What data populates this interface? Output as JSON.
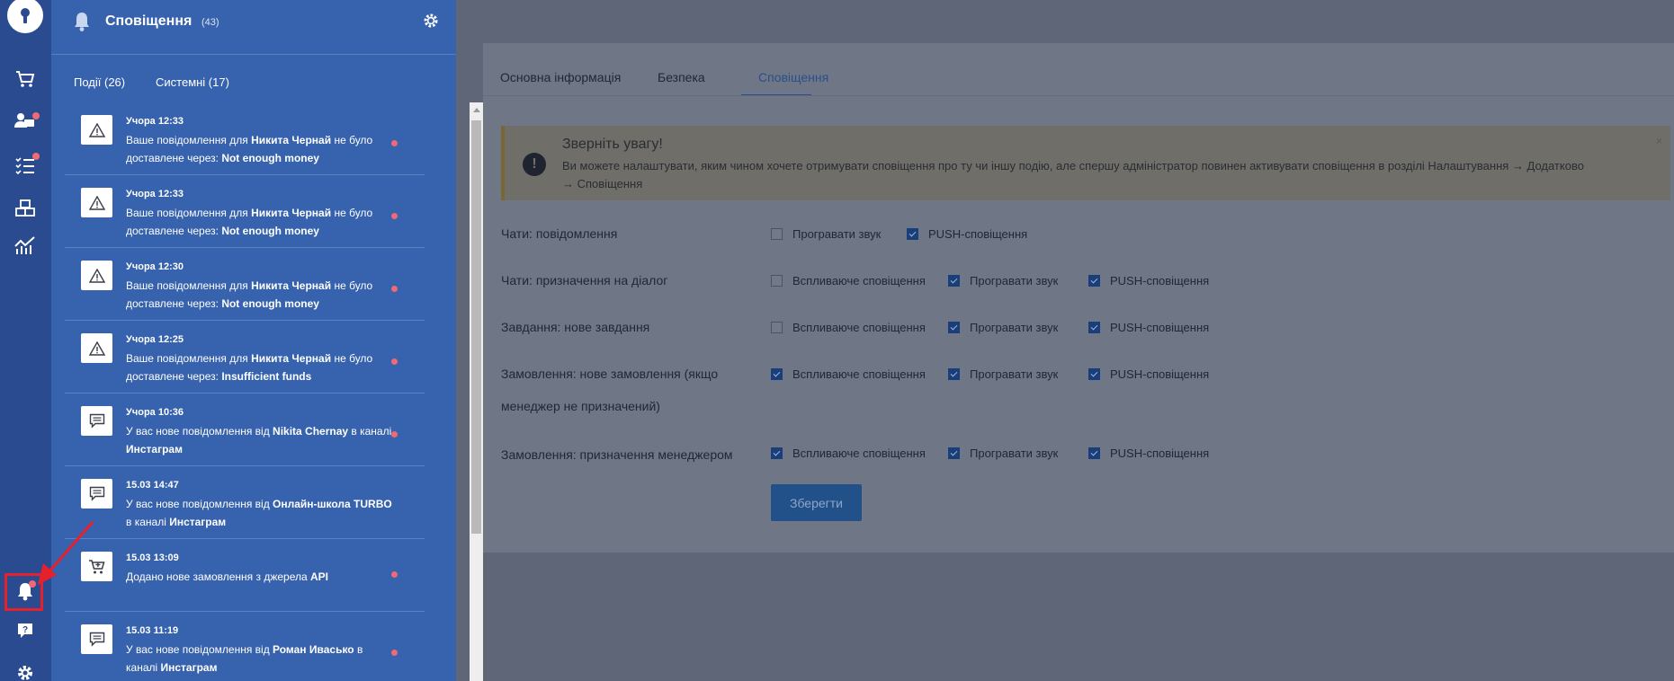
{
  "rail": {
    "items": [
      {
        "name": "cart-icon"
      },
      {
        "name": "contacts-icon"
      },
      {
        "name": "tasks-icon"
      },
      {
        "name": "boxes-icon"
      },
      {
        "name": "analytics-icon"
      },
      {
        "name": "bell-icon"
      },
      {
        "name": "help-icon"
      },
      {
        "name": "settings-icon"
      }
    ]
  },
  "panel": {
    "title": "Сповіщення",
    "count": "(43)",
    "tabs": [
      {
        "label": "Події (26)"
      },
      {
        "label": "Системні (17)"
      }
    ],
    "items": [
      {
        "icon": "warning-icon",
        "time": "Учора 12:33",
        "pre": "Ваше повідомлення для ",
        "name": "Никита Чернай",
        "mid": " не було доставлене через: ",
        "reason": "Not enough money",
        "post": ""
      },
      {
        "icon": "warning-icon",
        "time": "Учора 12:33",
        "pre": "Ваше повідомлення для ",
        "name": "Никита Чернай",
        "mid": " не було доставлене через: ",
        "reason": "Not enough money",
        "post": ""
      },
      {
        "icon": "warning-icon",
        "time": "Учора 12:30",
        "pre": "Ваше повідомлення для ",
        "name": "Никита Чернай",
        "mid": " не було доставлене через: ",
        "reason": "Not enough money",
        "post": ""
      },
      {
        "icon": "warning-icon",
        "time": "Учора 12:25",
        "pre": "Ваше повідомлення для ",
        "name": "Никита Чернай",
        "mid": " не було доставлене через: ",
        "reason": "Insufficient funds",
        "post": ""
      },
      {
        "icon": "message-icon",
        "time": "Учора 10:36",
        "pre": "У вас нове повідомлення від ",
        "name": "Nikita Chernay",
        "mid": " в каналі ",
        "reason": "Инстаграм",
        "post": ""
      },
      {
        "icon": "message-icon",
        "time": "15.03 14:47",
        "pre": "У вас нове повідомлення від ",
        "name": "Онлайн-школа TURBO",
        "mid": " в каналі ",
        "reason": "Инстаграм",
        "post": ""
      },
      {
        "icon": "cart-plus-icon",
        "time": "15.03 13:09",
        "pre": "Додано нове замовлення з джерела ",
        "name": "API",
        "mid": "",
        "reason": "",
        "post": ""
      },
      {
        "icon": "message-icon",
        "time": "15.03 11:19",
        "pre": "У вас нове повідомлення від ",
        "name": "Роман Ивасько",
        "mid": " в каналі ",
        "reason": "Инстаграм",
        "post": ""
      }
    ]
  },
  "main": {
    "tabs": [
      {
        "label": "Основна інформація"
      },
      {
        "label": "Безпека"
      },
      {
        "label": "Сповіщення"
      }
    ],
    "alert": {
      "title": "Зверніть увагу!",
      "text": "Ви можете налаштувати, яким чином хочете отримувати сповіщення про ту чи іншу подію, але спершу адміністратор повинен активувати сповіщення в розділі Налаштування → Додатково → Сповіщення",
      "close": "×"
    },
    "settings": [
      {
        "label": "Чати: повідомлення",
        "options": [
          {
            "label": "Програвати звук",
            "checked": false
          },
          {
            "label": "PUSH-сповіщення",
            "checked": true
          }
        ]
      },
      {
        "label": "Чати: призначення на діалог",
        "options": [
          {
            "label": "Вспливаюче сповіщення",
            "checked": false
          },
          {
            "label": "Програвати звук",
            "checked": true
          },
          {
            "label": "PUSH-сповіщення",
            "checked": true
          }
        ]
      },
      {
        "label": "Завдання: нове завдання",
        "options": [
          {
            "label": "Вспливаюче сповіщення",
            "checked": false
          },
          {
            "label": "Програвати звук",
            "checked": true
          },
          {
            "label": "PUSH-сповіщення",
            "checked": true
          }
        ]
      },
      {
        "label": "Замовлення: нове замовлення (якщо менеджер не призначений)",
        "options": [
          {
            "label": "Вспливаюче сповіщення",
            "checked": true
          },
          {
            "label": "Програвати звук",
            "checked": true
          },
          {
            "label": "PUSH-сповіщення",
            "checked": true
          }
        ]
      },
      {
        "label": "Замовлення: призначення менеджером",
        "options": [
          {
            "label": "Вспливаюче сповіщення",
            "checked": true
          },
          {
            "label": "Програвати звук",
            "checked": true
          },
          {
            "label": "PUSH-сповіщення",
            "checked": true
          }
        ]
      }
    ],
    "save_label": "Зберегти"
  },
  "colors": {
    "rail": "#2a4b8f",
    "panel": "#3762ad",
    "unread_dot": "#ef6b73",
    "annotation": "#e6202c"
  }
}
